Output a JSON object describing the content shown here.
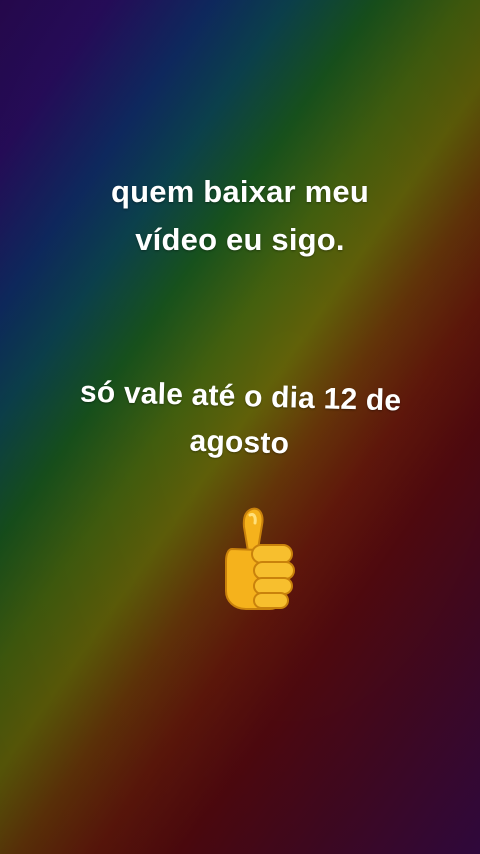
{
  "post": {
    "line1": "quem baixar meu",
    "line2": "vídeo eu sigo.",
    "line3": "só vale até o dia 12 de",
    "line4": "agosto",
    "emoji_icon": "thumbs-up-icon"
  },
  "colors": {
    "text": "#ffffff",
    "thumb_fill": "#f5b21c",
    "thumb_shadow": "#c9820c"
  }
}
